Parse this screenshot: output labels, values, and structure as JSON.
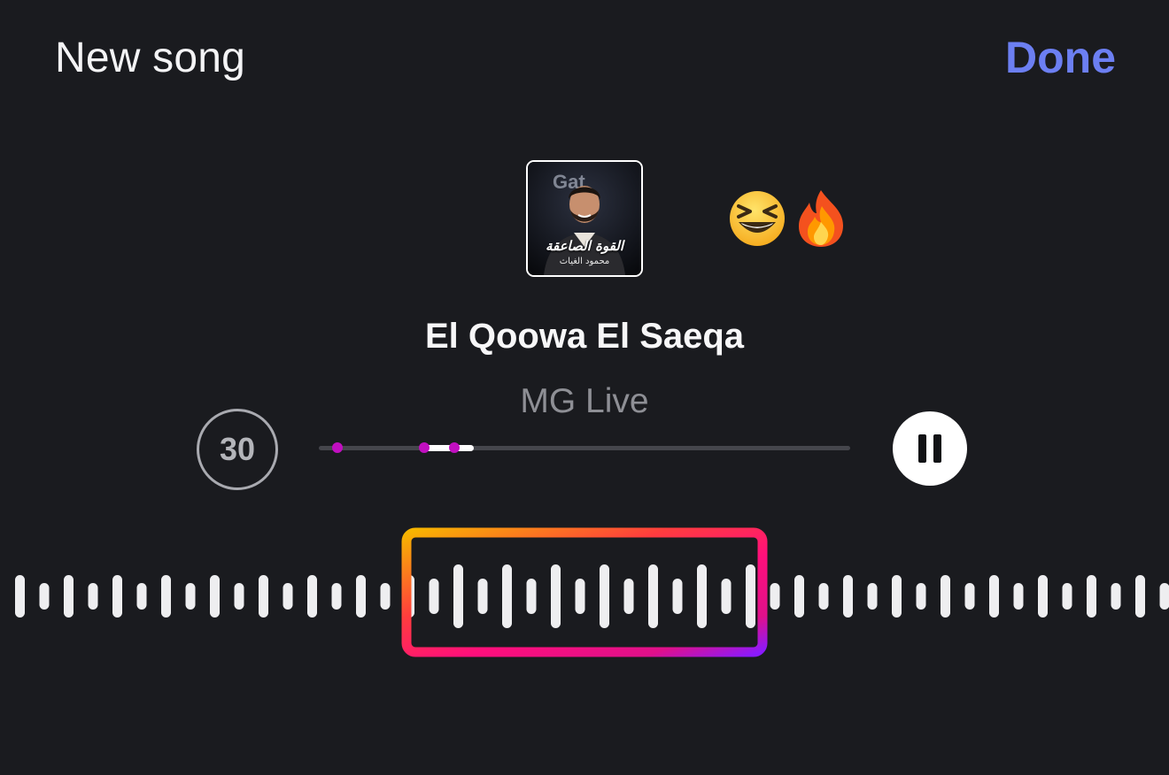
{
  "header": {
    "title": "New song",
    "done_label": "Done"
  },
  "album": {
    "cover_title": "القوة الصاعقة",
    "cover_subtitle": "محمود الغياث"
  },
  "reactions": [
    "grinning-squinting-face-emoji",
    "fire-emoji"
  ],
  "song": {
    "title": "El Qoowa El Saeqa",
    "artist": "MG Live"
  },
  "player": {
    "clip_duration": "30",
    "state": "playing",
    "progress_fraction": 0.29
  },
  "colors": {
    "background": "#1a1b1f",
    "accent": "#6c7ff2",
    "marker": "#c10fc0",
    "selection_gradient": [
      "#f7b500",
      "#ff2d55",
      "#e0108a",
      "#8a1aff"
    ]
  }
}
